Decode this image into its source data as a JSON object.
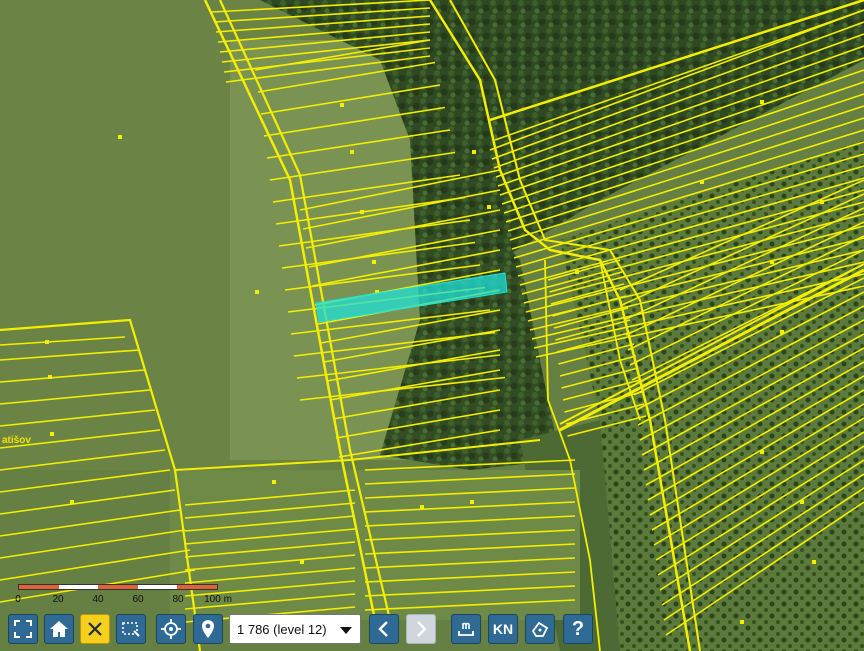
{
  "colors": {
    "parcel_line": "#f4ef00",
    "highlight": "#1fe0d8",
    "toolbar_button": "#2e6a93",
    "toolbar_active": "#f7cf1d"
  },
  "map": {
    "place_label": "atišov"
  },
  "scale": {
    "labels": [
      "0",
      "20",
      "40",
      "60",
      "80",
      "100 m"
    ],
    "colors": [
      "#e0623a",
      "#ffffff",
      "#e0623a",
      "#ffffff",
      "#e0623a"
    ]
  },
  "toolbar": {
    "scale_select": {
      "value": "1 786 (level 12)"
    },
    "buttons": [
      {
        "name": "fullscreen-button",
        "icon": "fullscreen-icon"
      },
      {
        "name": "home-button",
        "icon": "home-icon"
      },
      {
        "name": "clear-selection-button",
        "icon": "close-icon"
      },
      {
        "name": "select-area-button",
        "icon": "select-area-icon"
      },
      {
        "name": "locate-button",
        "icon": "crosshair-icon"
      },
      {
        "name": "marker-button",
        "icon": "map-pin-icon"
      },
      {
        "name": "zoom-previous-button",
        "icon": "chevron-left-icon"
      },
      {
        "name": "zoom-next-button",
        "icon": "chevron-right-icon"
      },
      {
        "name": "measure-button",
        "icon": "measure-icon"
      },
      {
        "name": "cadastre-button",
        "icon": "kn-icon",
        "label": "KN"
      },
      {
        "name": "drawing-button",
        "icon": "pen-icon"
      },
      {
        "name": "help-button",
        "icon": "help-icon",
        "label": "?"
      }
    ]
  }
}
